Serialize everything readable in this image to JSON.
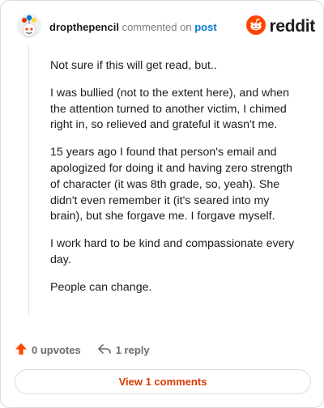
{
  "header": {
    "author": "dropthepencil",
    "commented_text": "commented on",
    "post_link": "post",
    "brand": "reddit"
  },
  "comment": {
    "paragraphs": [
      "Not sure if this will get read, but..",
      "I was bullied (not to the extent here), and when the attention turned to another victim, I chimed right in, so relieved and grateful it wasn't me.",
      "15 years ago I found that person's email and apologized for doing it and having zero strength of character (it was 8th grade, so, yeah). She didn't even remember it (it's seared into my brain), but she forgave me. I forgave myself.",
      "I work hard to be kind and compassionate every day.",
      "People can change."
    ]
  },
  "actions": {
    "upvotes": "0 upvotes",
    "reply": "1 reply"
  },
  "view_comments": "View 1 comments",
  "colors": {
    "brand": "#ff4500",
    "link": "#0079d3",
    "view_button_text": "#d93a00"
  }
}
